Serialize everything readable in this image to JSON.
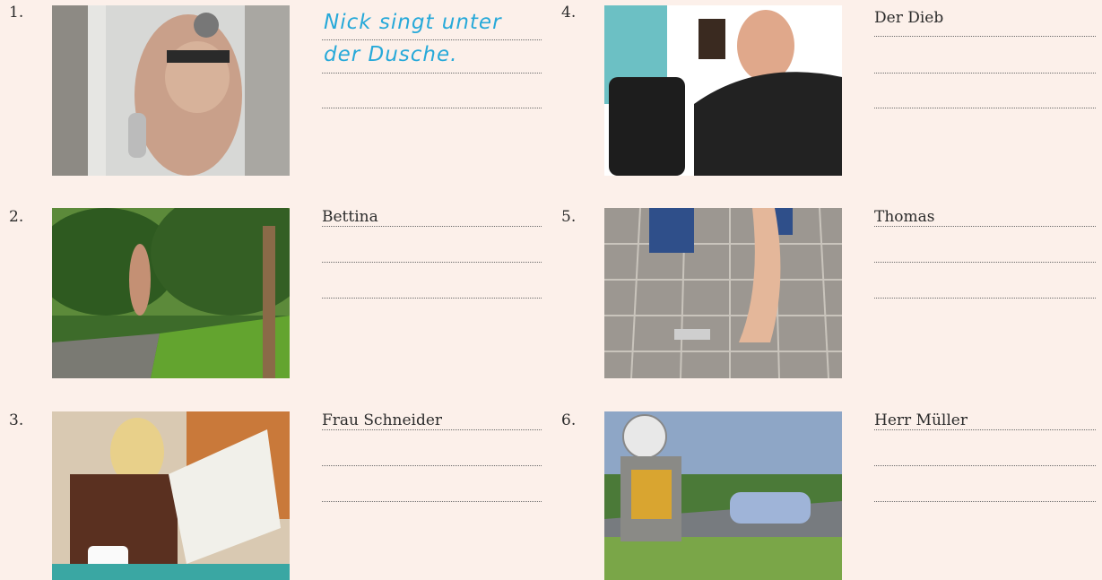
{
  "exercises": [
    {
      "number": "1.",
      "photo": "man-singing-in-shower",
      "prompt": "",
      "answer_line1": "Nick singt unter",
      "answer_line2": "der Dusche."
    },
    {
      "number": "2.",
      "photo": "woman-jogging-in-park",
      "prompt": "Bettina"
    },
    {
      "number": "3.",
      "photo": "woman-reading-newspaper",
      "prompt": "Frau Schneider"
    },
    {
      "number": "4.",
      "photo": "thief-stealing-wallet",
      "prompt": "Der Dieb"
    },
    {
      "number": "5.",
      "photo": "picking-up-keys",
      "prompt": "Thomas"
    },
    {
      "number": "6.",
      "photo": "speed-camera",
      "prompt": "Herr Müller"
    }
  ],
  "colors": {
    "background": "#fcf0ea",
    "handwriting": "#27a9d9"
  }
}
